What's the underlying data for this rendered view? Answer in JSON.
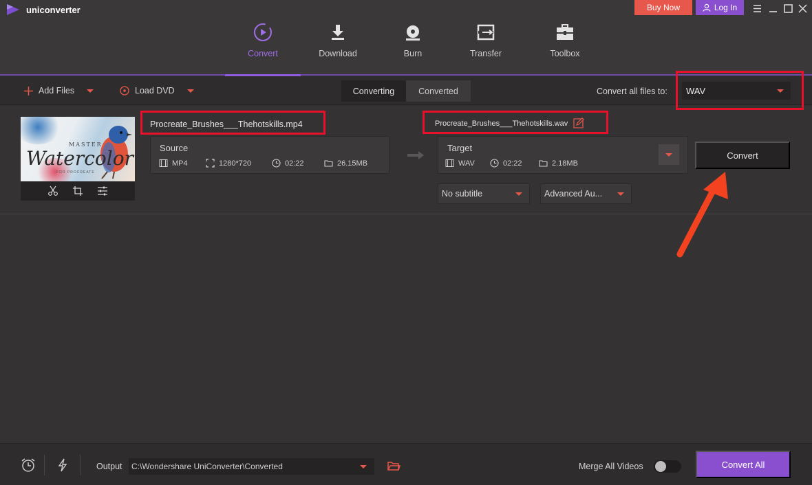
{
  "app": {
    "name": "uniconverter"
  },
  "titlebar": {
    "buy_now": "Buy Now",
    "log_in": "Log In"
  },
  "nav": {
    "items": [
      {
        "label": "Convert",
        "icon": "convert-icon",
        "active": true
      },
      {
        "label": "Download",
        "icon": "download-icon",
        "active": false
      },
      {
        "label": "Burn",
        "icon": "burn-disc-icon",
        "active": false
      },
      {
        "label": "Transfer",
        "icon": "transfer-icon",
        "active": false
      },
      {
        "label": "Toolbox",
        "icon": "toolbox-icon",
        "active": false
      }
    ]
  },
  "toolbar": {
    "add_files": "Add Files",
    "load_dvd": "Load DVD",
    "tabs": [
      "Converting",
      "Converted"
    ],
    "active_tab": "Converting",
    "convert_all_label": "Convert all files to:",
    "convert_all_format": "WAV"
  },
  "file": {
    "thumbnail": {
      "line1": "MASTER",
      "line2": "Watercolor",
      "line3": "FOR PROCREATE"
    },
    "source_name": "Procreate_Brushes___Thehotskills.mp4",
    "source": {
      "title": "Source",
      "format": "MP4",
      "resolution": "1280*720",
      "duration": "02:22",
      "size": "26.15MB"
    },
    "target_name": "Procreate_Brushes___Thehotskills.wav",
    "target": {
      "title": "Target",
      "format": "WAV",
      "duration": "02:22",
      "size": "2.18MB"
    },
    "subtitle": "No subtitle",
    "audio": "Advanced Au...",
    "convert_button": "Convert"
  },
  "bottom": {
    "output_label": "Output",
    "output_path": "C:\\Wondershare UniConverter\\Converted",
    "merge_label": "Merge All Videos",
    "merge_enabled": false,
    "convert_all": "Convert All"
  },
  "colors": {
    "accent_purple": "#8a4fcf",
    "accent_red": "#e8574c",
    "annotation_red": "#e8102a"
  }
}
